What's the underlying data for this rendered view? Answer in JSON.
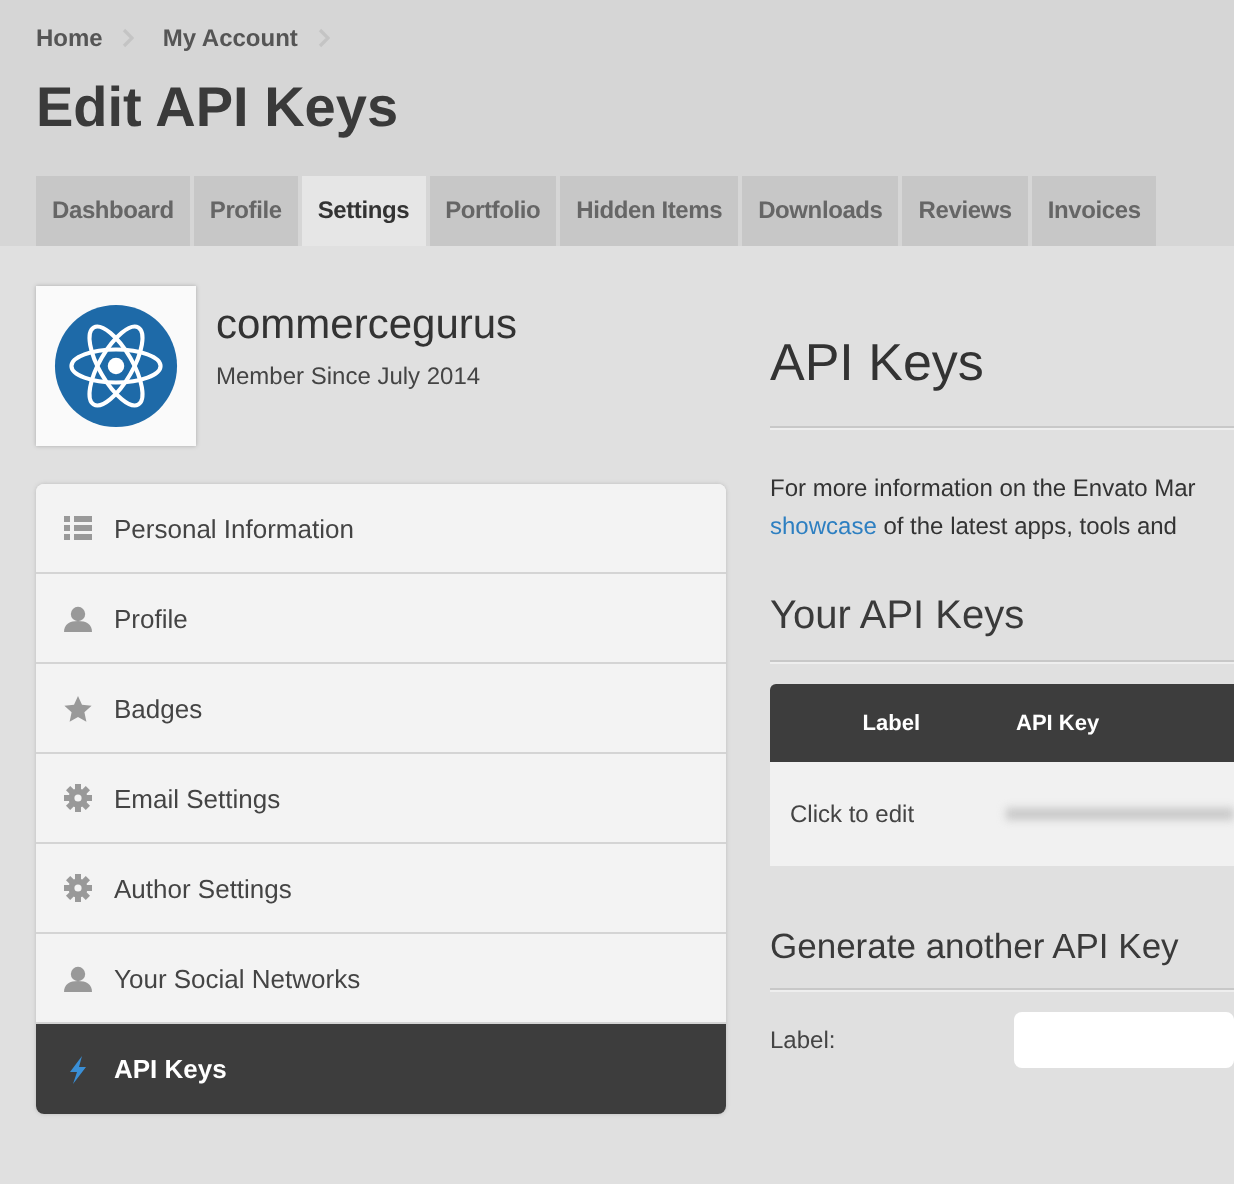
{
  "breadcrumbs": [
    "Home",
    "My Account"
  ],
  "title": "Edit API Keys",
  "tabs": [
    {
      "label": "Dashboard",
      "selected": false
    },
    {
      "label": "Profile",
      "selected": false
    },
    {
      "label": "Settings",
      "selected": true
    },
    {
      "label": "Portfolio",
      "selected": false
    },
    {
      "label": "Hidden Items",
      "selected": false
    },
    {
      "label": "Downloads",
      "selected": false
    },
    {
      "label": "Reviews",
      "selected": false
    },
    {
      "label": "Invoices",
      "selected": false
    }
  ],
  "profile": {
    "username": "commercegurus",
    "member_since": "Member Since July 2014"
  },
  "sidebar": {
    "items": [
      {
        "label": "Personal Information",
        "selected": false
      },
      {
        "label": "Profile",
        "selected": false
      },
      {
        "label": "Badges",
        "selected": false
      },
      {
        "label": "Email Settings",
        "selected": false
      },
      {
        "label": "Author Settings",
        "selected": false
      },
      {
        "label": "Your Social Networks",
        "selected": false
      },
      {
        "label": "API Keys",
        "selected": true
      }
    ]
  },
  "content": {
    "heading": "API Keys",
    "intro_line_1": "For more information on the Envato Mar",
    "intro_link": "showcase",
    "intro_line_2": "of the latest apps, tools and",
    "keys_heading": "Your API Keys",
    "table": {
      "columns": [
        "Label",
        "API Key"
      ],
      "rows": [
        {
          "label": "Click to edit"
        }
      ]
    },
    "generate_heading": "Generate another API Key",
    "form": {
      "label": "Label:"
    }
  }
}
